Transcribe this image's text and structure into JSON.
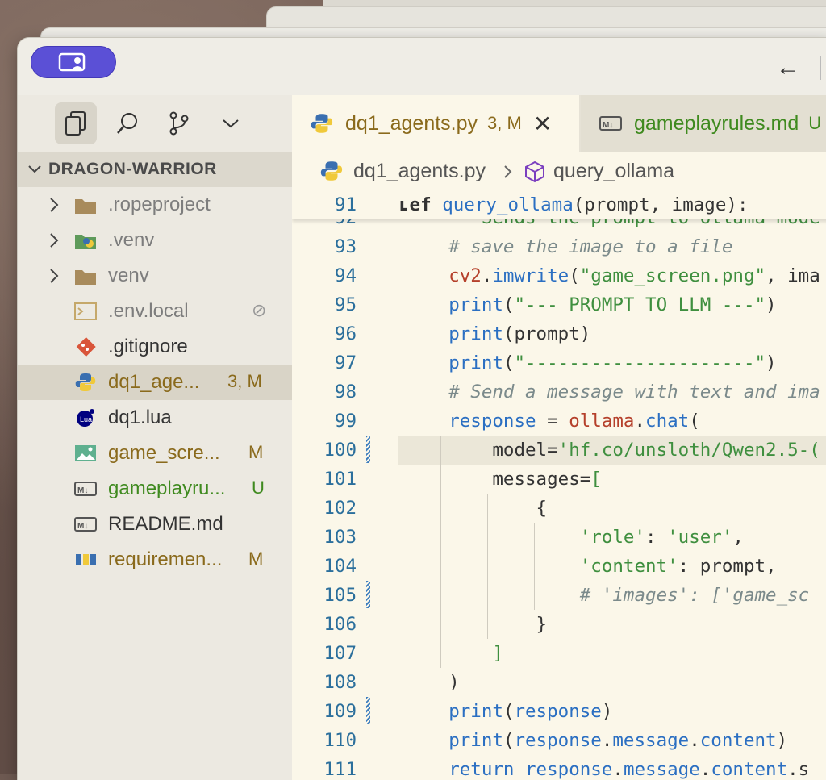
{
  "sidebar": {
    "section_title": "DRAGON-WARRIOR",
    "items": [
      {
        "name": ".ropeproject",
        "type": "folder",
        "icon": "folder-icon",
        "color": "#7d7d7d",
        "badge": ""
      },
      {
        "name": ".venv",
        "type": "folder",
        "icon": "python-folder-icon",
        "color": "#7d7d7d",
        "badge": ""
      },
      {
        "name": "venv",
        "type": "folder",
        "icon": "folder-icon",
        "color": "#7d7d7d",
        "badge": ""
      },
      {
        "name": ".env.local",
        "type": "file",
        "icon": "terminal-file-icon",
        "color": "#7d7d7d",
        "badge": "⊘"
      },
      {
        "name": ".gitignore",
        "type": "file",
        "icon": "git-icon",
        "color": "#333333",
        "badge": ""
      },
      {
        "name": "dq1_age...",
        "type": "file",
        "icon": "python-icon",
        "color": "#8a6a1c",
        "badge": "3, M"
      },
      {
        "name": "dq1.lua",
        "type": "file",
        "icon": "lua-icon",
        "color": "#333333",
        "badge": ""
      },
      {
        "name": "game_scre...",
        "type": "file",
        "icon": "image-icon",
        "color": "#8a6a1c",
        "badge": "M"
      },
      {
        "name": "gameplayru...",
        "type": "file",
        "icon": "markdown-icon",
        "color": "#3f8a1f",
        "badge": "U"
      },
      {
        "name": "README.md",
        "type": "file",
        "icon": "markdown-icon",
        "color": "#333333",
        "badge": ""
      },
      {
        "name": "requiremen...",
        "type": "file",
        "icon": "pip-icon",
        "color": "#8a6a1c",
        "badge": "M"
      }
    ]
  },
  "tabs": [
    {
      "label": "dq1_agents.py",
      "status": "3, M",
      "active": true
    },
    {
      "label": "gameplayrules.md",
      "status": "U",
      "active": false
    }
  ],
  "breadcrumb": {
    "file": "dq1_agents.py",
    "symbol": "query_ollama"
  },
  "editor": {
    "sticky_line": {
      "num": "91",
      "text": "def query_ollama(prompt, image):"
    },
    "lines": [
      {
        "num": "92",
        "text": "    \"\"\"Sends the prompt to ollama mode"
      },
      {
        "num": "93",
        "text": "    # save the image to a file"
      },
      {
        "num": "94",
        "text": "    cv2.imwrite(\"game_screen.png\", ima"
      },
      {
        "num": "95",
        "text": "    print(\"--- PROMPT TO LLM ---\")"
      },
      {
        "num": "96",
        "text": "    print(prompt)"
      },
      {
        "num": "97",
        "text": "    print(\"---------------------\")"
      },
      {
        "num": "98",
        "text": "    # Send a message with text and ima"
      },
      {
        "num": "99",
        "text": "    response = ollama.chat("
      },
      {
        "num": "100",
        "text": "        model='hf.co/unsloth/Qwen2.5-("
      },
      {
        "num": "101",
        "text": "        messages=["
      },
      {
        "num": "102",
        "text": "            {"
      },
      {
        "num": "103",
        "text": "                'role': 'user',"
      },
      {
        "num": "104",
        "text": "                'content': prompt,"
      },
      {
        "num": "105",
        "text": "                # 'images': ['game_sc"
      },
      {
        "num": "106",
        "text": "            }"
      },
      {
        "num": "107",
        "text": "        ]"
      },
      {
        "num": "108",
        "text": "    )"
      },
      {
        "num": "109",
        "text": "    print(response)"
      },
      {
        "num": "110",
        "text": "    print(response.message.content)"
      },
      {
        "num": "111",
        "text": "    return response.message.content.s"
      }
    ]
  },
  "colors": {
    "accent": "#5b50d6",
    "modified": "#8a6a1c",
    "untracked": "#3f8a1f",
    "line_number": "#2b6f9c"
  }
}
